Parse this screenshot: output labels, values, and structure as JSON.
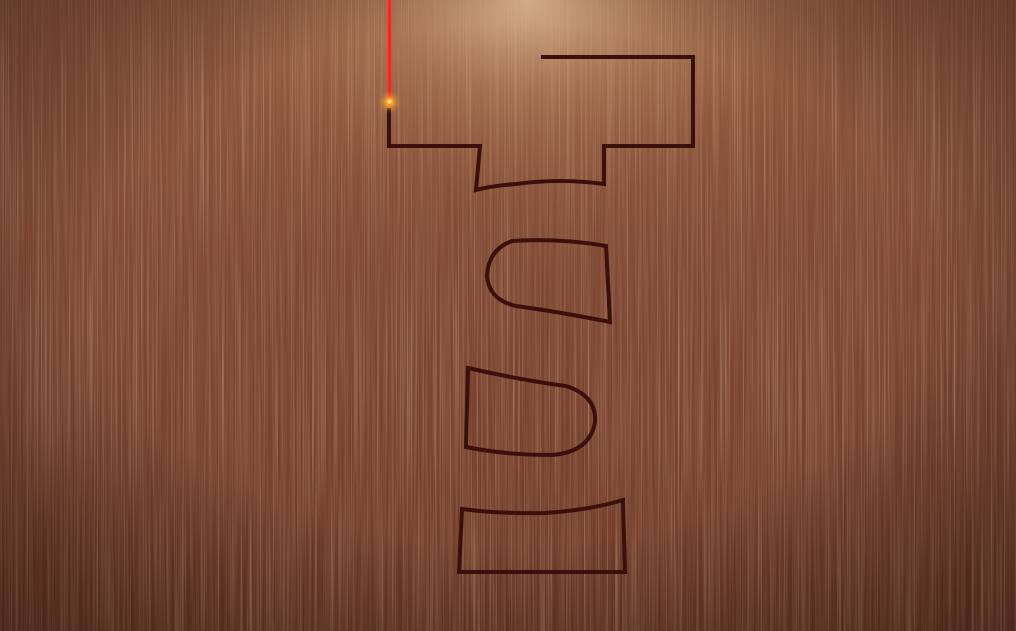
{
  "game": {
    "surface": "wood-plank",
    "colors": {
      "wood_base": "#7b4531",
      "wood_light": "#c99a73",
      "wood_dark": "#4d2417",
      "groove": "#3b0f0b",
      "laser": "#ff1e1e",
      "laser_tip": "#ff9a1a"
    },
    "icons": {
      "cutter": "laser-cutter-icon"
    },
    "cut_progress": 0.02
  }
}
